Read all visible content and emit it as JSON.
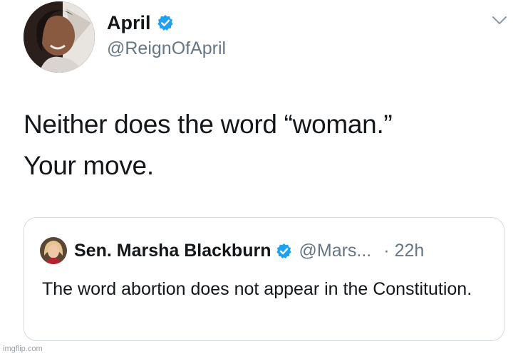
{
  "author": {
    "display_name": "April",
    "handle": "@ReignOfApril",
    "verified": true
  },
  "tweet": {
    "lines": [
      "Neither does the word “woman.”",
      "Your move."
    ]
  },
  "quoted_tweet": {
    "display_name": "Sen. Marsha Blackburn",
    "handle": "@Mars...",
    "separator": "·",
    "time": "22h",
    "text": "The word abortion does not appear in the Constitution.",
    "verified": true
  },
  "icons": {
    "verified": "verified-badge-icon",
    "menu": "chevron-down-icon"
  },
  "colors": {
    "verified_blue": "#1da1f2",
    "secondary_text": "#657786",
    "border": "#d6dbe0"
  },
  "watermark": "imgflip.com"
}
